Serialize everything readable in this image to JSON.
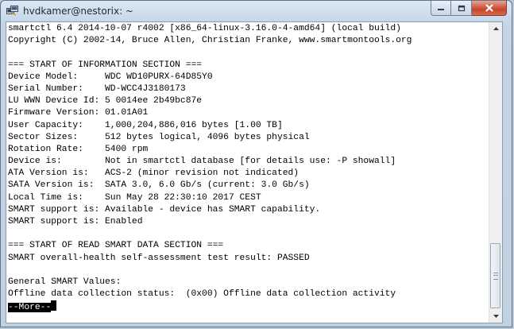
{
  "window": {
    "title": "hvdkamer@nestorix: ~",
    "icons": {
      "app": "putty-icon",
      "minimize": "minimize-icon",
      "maximize": "maximize-icon",
      "close": "close-icon"
    }
  },
  "terminal": {
    "lines": [
      "smartctl 6.4 2014-10-07 r4002 [x86_64-linux-3.16.0-4-amd64] (local build)",
      "Copyright (C) 2002-14, Bruce Allen, Christian Franke, www.smartmontools.org",
      "",
      "=== START OF INFORMATION SECTION ===",
      "Device Model:     WDC WD10PURX-64D85Y0",
      "Serial Number:    WD-WCC4J3180173",
      "LU WWN Device Id: 5 0014ee 2b49bc87e",
      "Firmware Version: 01.01A01",
      "User Capacity:    1,000,204,886,016 bytes [1.00 TB]",
      "Sector Sizes:     512 bytes logical, 4096 bytes physical",
      "Rotation Rate:    5400 rpm",
      "Device is:        Not in smartctl database [for details use: -P showall]",
      "ATA Version is:   ACS-2 (minor revision not indicated)",
      "SATA Version is:  SATA 3.0, 6.0 Gb/s (current: 3.0 Gb/s)",
      "Local Time is:    Sun May 28 22:30:10 2017 CEST",
      "SMART support is: Available - device has SMART capability.",
      "SMART support is: Enabled",
      "",
      "=== START OF READ SMART DATA SECTION ===",
      "SMART overall-health self-assessment test result: PASSED",
      "",
      "General SMART Values:",
      "Offline data collection status:  (0x00) Offline data collection activity"
    ],
    "pager_prompt": "--More--"
  },
  "colors": {
    "background": "#ffffff",
    "text": "#000000",
    "close_button": "#c8452b"
  }
}
